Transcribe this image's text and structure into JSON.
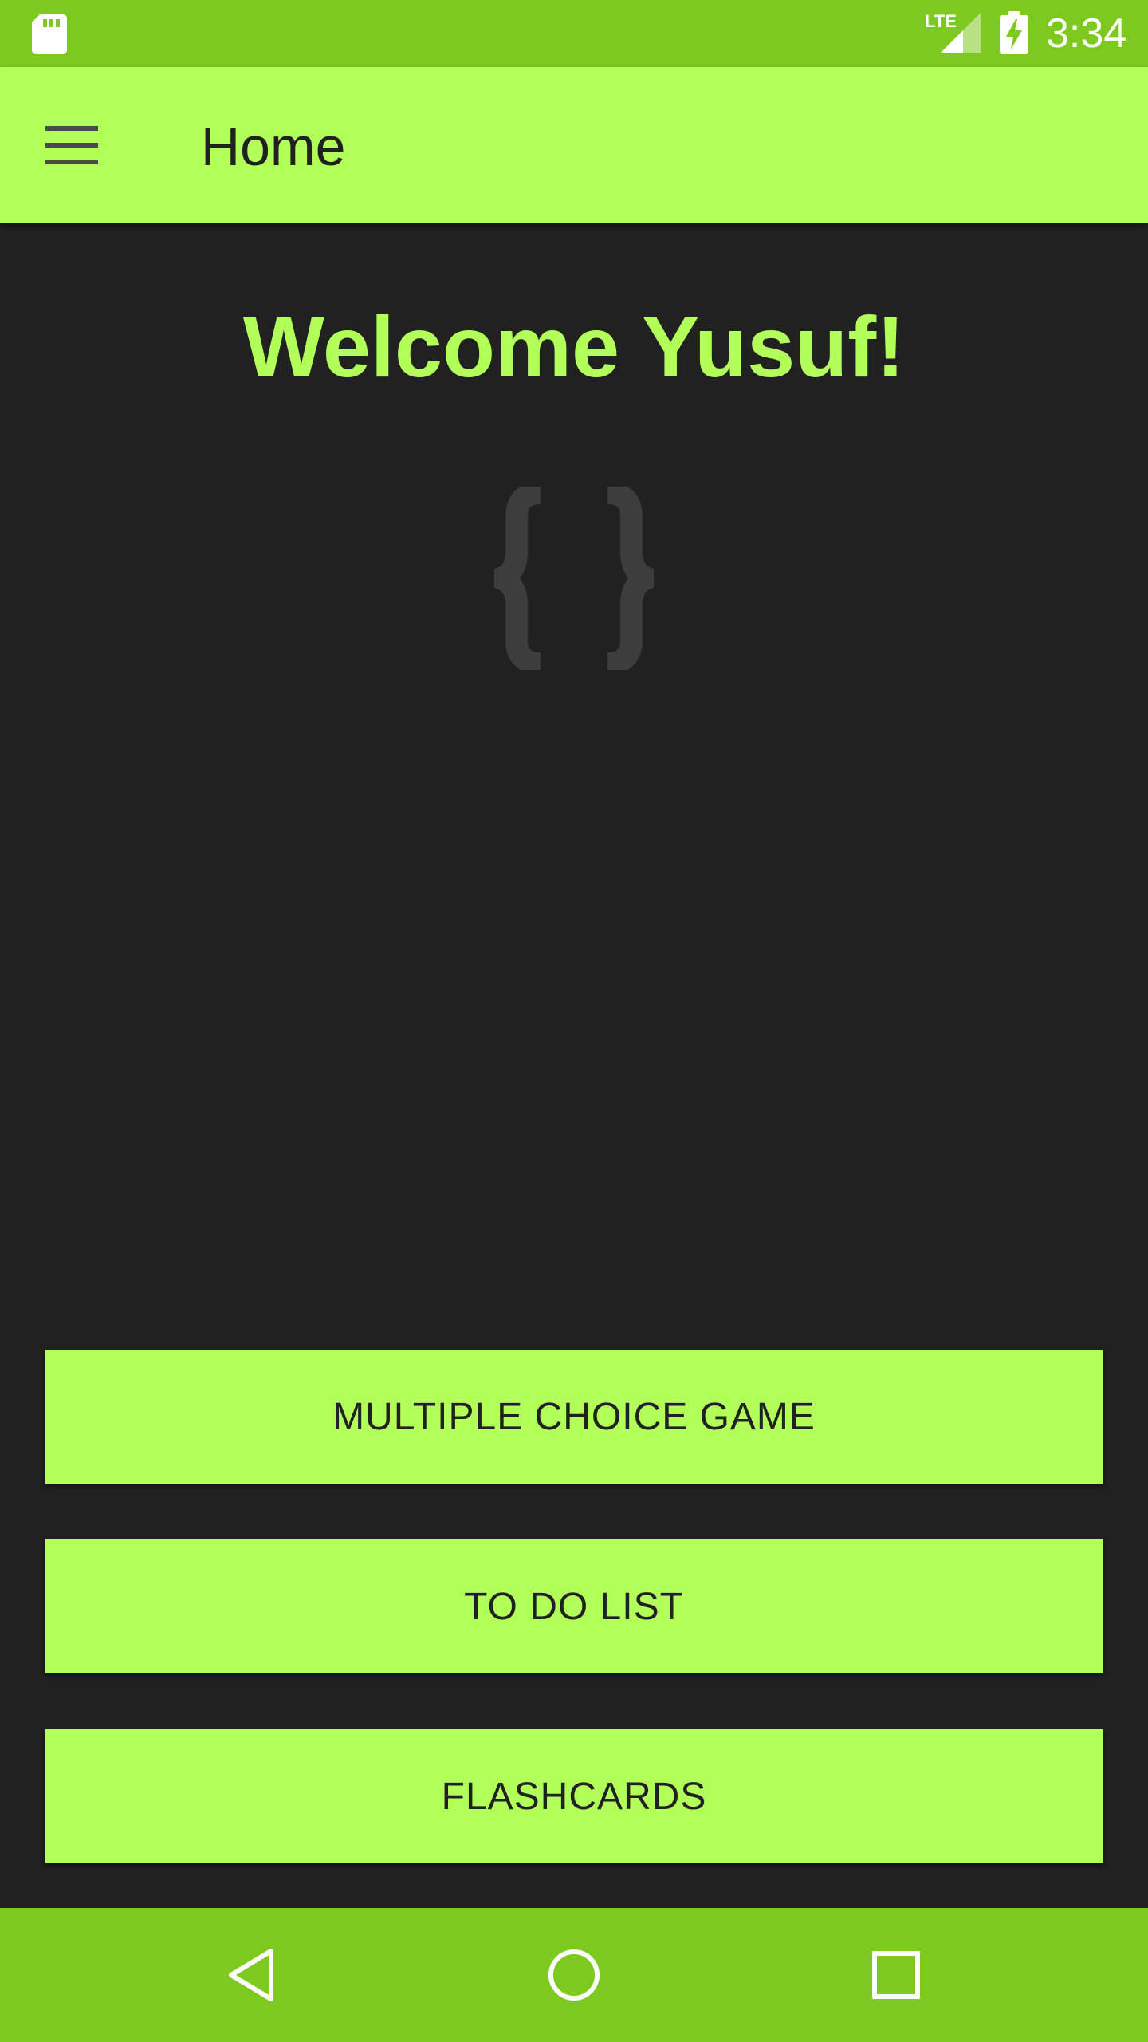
{
  "status_bar": {
    "time": "3:34",
    "network_label": "LTE",
    "icons": [
      "sd-card-icon",
      "lte-signal-icon",
      "battery-charging-icon"
    ]
  },
  "app_bar": {
    "title": "Home",
    "menu_icon": "hamburger-menu-icon"
  },
  "main": {
    "welcome_text": "Welcome Yusuf!",
    "logo_icon": "curly-braces-icon",
    "buttons": [
      {
        "label": "MULTIPLE CHOICE GAME"
      },
      {
        "label": "TO DO LIST"
      },
      {
        "label": "FLASHCARDS"
      }
    ]
  },
  "nav_bar": {
    "icons": [
      "back-icon",
      "home-icon",
      "recents-icon"
    ]
  },
  "colors": {
    "status_bar": "#7ec920",
    "accent": "#b2ff59",
    "background": "#212121",
    "text_dark": "#212121",
    "logo_gray": "#3d3d3d"
  }
}
